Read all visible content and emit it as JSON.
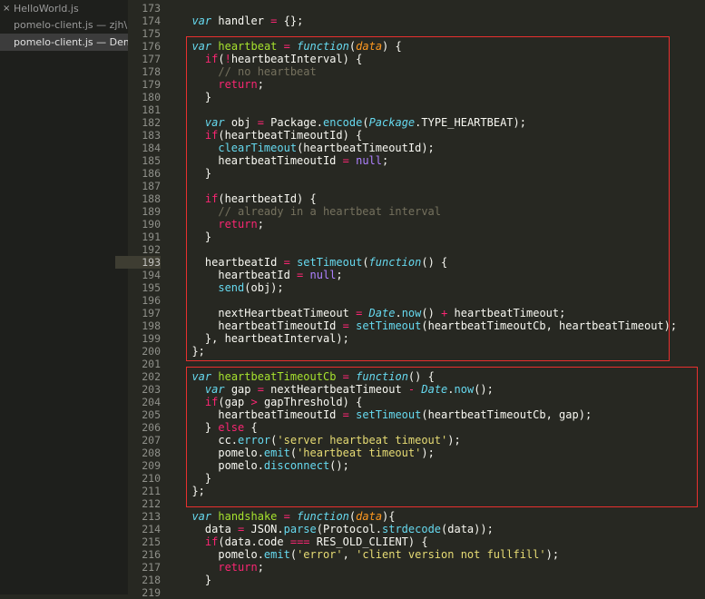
{
  "sidebar": {
    "files": [
      {
        "label": "HelloWorld.js",
        "close_icon": "×"
      },
      {
        "label": "pomelo-client.js — zjh\\..."
      },
      {
        "label": "pomelo-client.js — Demo"
      }
    ]
  },
  "editor": {
    "current_line": 193,
    "highlight_color": "#e8302f",
    "lines": [
      {
        "n": 173,
        "t": []
      },
      {
        "n": 174,
        "t": [
          [
            "",
            "  "
          ],
          [
            "st",
            "var"
          ],
          [
            "",
            " handler "
          ],
          [
            "op",
            "="
          ],
          [
            "",
            " {};"
          ]
        ]
      },
      {
        "n": 175,
        "t": []
      },
      {
        "n": 176,
        "t": [
          [
            "",
            "  "
          ],
          [
            "st",
            "var"
          ],
          [
            "",
            " "
          ],
          [
            "fn",
            "heartbeat"
          ],
          [
            "",
            " "
          ],
          [
            "op",
            "="
          ],
          [
            "",
            " "
          ],
          [
            "st",
            "function"
          ],
          [
            "",
            "("
          ],
          [
            "pa",
            "data"
          ],
          [
            "",
            ") {"
          ]
        ]
      },
      {
        "n": 177,
        "t": [
          [
            "",
            "    "
          ],
          [
            "kw",
            "if"
          ],
          [
            "",
            "("
          ],
          [
            "op",
            "!"
          ],
          [
            "",
            "heartbeatInterval) {"
          ]
        ]
      },
      {
        "n": 178,
        "t": [
          [
            "",
            "      "
          ],
          [
            "cm",
            "// no heartbeat"
          ]
        ]
      },
      {
        "n": 179,
        "t": [
          [
            "",
            "      "
          ],
          [
            "kw",
            "return"
          ],
          [
            "",
            ";"
          ]
        ]
      },
      {
        "n": 180,
        "t": [
          [
            "",
            "    }"
          ]
        ]
      },
      {
        "n": 181,
        "t": []
      },
      {
        "n": 182,
        "t": [
          [
            "",
            "    "
          ],
          [
            "st",
            "var"
          ],
          [
            "",
            " obj "
          ],
          [
            "op",
            "="
          ],
          [
            "",
            " Package."
          ],
          [
            "sp",
            "encode"
          ],
          [
            "",
            "("
          ],
          [
            "st",
            "Package"
          ],
          [
            "",
            ".TYPE_HEARTBEAT);"
          ]
        ]
      },
      {
        "n": 183,
        "t": [
          [
            "",
            "    "
          ],
          [
            "kw",
            "if"
          ],
          [
            "",
            "(heartbeatTimeoutId) {"
          ]
        ]
      },
      {
        "n": 184,
        "t": [
          [
            "",
            "      "
          ],
          [
            "sp",
            "clearTimeout"
          ],
          [
            "",
            "(heartbeatTimeoutId);"
          ]
        ]
      },
      {
        "n": 185,
        "t": [
          [
            "",
            "      heartbeatTimeoutId "
          ],
          [
            "op",
            "="
          ],
          [
            "",
            " "
          ],
          [
            "cn",
            "null"
          ],
          [
            "",
            ";"
          ]
        ]
      },
      {
        "n": 186,
        "t": [
          [
            "",
            "    }"
          ]
        ]
      },
      {
        "n": 187,
        "t": []
      },
      {
        "n": 188,
        "t": [
          [
            "",
            "    "
          ],
          [
            "kw",
            "if"
          ],
          [
            "",
            "(heartbeatId) {"
          ]
        ]
      },
      {
        "n": 189,
        "t": [
          [
            "",
            "      "
          ],
          [
            "cm",
            "// already in a heartbeat interval"
          ]
        ]
      },
      {
        "n": 190,
        "t": [
          [
            "",
            "      "
          ],
          [
            "kw",
            "return"
          ],
          [
            "",
            ";"
          ]
        ]
      },
      {
        "n": 191,
        "t": [
          [
            "",
            "    }"
          ]
        ]
      },
      {
        "n": 192,
        "t": []
      },
      {
        "n": 193,
        "t": [
          [
            "",
            "    heartbeatId "
          ],
          [
            "op",
            "="
          ],
          [
            "",
            " "
          ],
          [
            "sp",
            "setTimeout"
          ],
          [
            "",
            "("
          ],
          [
            "st",
            "function"
          ],
          [
            "",
            "() {"
          ]
        ]
      },
      {
        "n": 194,
        "t": [
          [
            "",
            "      heartbeatId "
          ],
          [
            "op",
            "="
          ],
          [
            "",
            " "
          ],
          [
            "cn",
            "null"
          ],
          [
            "",
            ";"
          ]
        ]
      },
      {
        "n": 195,
        "t": [
          [
            "",
            "      "
          ],
          [
            "sp",
            "send"
          ],
          [
            "",
            "(obj);"
          ]
        ]
      },
      {
        "n": 196,
        "t": []
      },
      {
        "n": 197,
        "t": [
          [
            "",
            "      nextHeartbeatTimeout "
          ],
          [
            "op",
            "="
          ],
          [
            "",
            " "
          ],
          [
            "st",
            "Date"
          ],
          [
            "",
            "."
          ],
          [
            "sp",
            "now"
          ],
          [
            "",
            "() "
          ],
          [
            "op",
            "+"
          ],
          [
            "",
            " heartbeatTimeout;"
          ]
        ]
      },
      {
        "n": 198,
        "t": [
          [
            "",
            "      heartbeatTimeoutId "
          ],
          [
            "op",
            "="
          ],
          [
            "",
            " "
          ],
          [
            "sp",
            "setTimeout"
          ],
          [
            "",
            "(heartbeatTimeoutCb, heartbeatTimeout);"
          ]
        ]
      },
      {
        "n": 199,
        "t": [
          [
            "",
            "    }, heartbeatInterval);"
          ]
        ]
      },
      {
        "n": 200,
        "t": [
          [
            "",
            "  };"
          ]
        ]
      },
      {
        "n": 201,
        "t": []
      },
      {
        "n": 202,
        "t": [
          [
            "",
            "  "
          ],
          [
            "st",
            "var"
          ],
          [
            "",
            " "
          ],
          [
            "fn",
            "heartbeatTimeoutCb"
          ],
          [
            "",
            " "
          ],
          [
            "op",
            "="
          ],
          [
            "",
            " "
          ],
          [
            "st",
            "function"
          ],
          [
            "",
            "() {"
          ]
        ]
      },
      {
        "n": 203,
        "t": [
          [
            "",
            "    "
          ],
          [
            "st",
            "var"
          ],
          [
            "",
            " gap "
          ],
          [
            "op",
            "="
          ],
          [
            "",
            " nextHeartbeatTimeout "
          ],
          [
            "op",
            "-"
          ],
          [
            "",
            " "
          ],
          [
            "st",
            "Date"
          ],
          [
            "",
            "."
          ],
          [
            "sp",
            "now"
          ],
          [
            "",
            "();"
          ]
        ]
      },
      {
        "n": 204,
        "t": [
          [
            "",
            "    "
          ],
          [
            "kw",
            "if"
          ],
          [
            "",
            "(gap "
          ],
          [
            "op",
            ">"
          ],
          [
            "",
            " gapThreshold) {"
          ]
        ]
      },
      {
        "n": 205,
        "t": [
          [
            "",
            "      heartbeatTimeoutId "
          ],
          [
            "op",
            "="
          ],
          [
            "",
            " "
          ],
          [
            "sp",
            "setTimeout"
          ],
          [
            "",
            "(heartbeatTimeoutCb, gap);"
          ]
        ]
      },
      {
        "n": 206,
        "t": [
          [
            "",
            "    } "
          ],
          [
            "kw",
            "else"
          ],
          [
            "",
            " {"
          ]
        ]
      },
      {
        "n": 207,
        "t": [
          [
            "",
            "      cc."
          ],
          [
            "sp",
            "error"
          ],
          [
            "",
            "("
          ],
          [
            "str",
            "'server heartbeat timeout'"
          ],
          [
            "",
            ");"
          ]
        ]
      },
      {
        "n": 208,
        "t": [
          [
            "",
            "      pomelo."
          ],
          [
            "sp",
            "emit"
          ],
          [
            "",
            "("
          ],
          [
            "str",
            "'heartbeat timeout'"
          ],
          [
            "",
            ");"
          ]
        ]
      },
      {
        "n": 209,
        "t": [
          [
            "",
            "      pomelo."
          ],
          [
            "sp",
            "disconnect"
          ],
          [
            "",
            "();"
          ]
        ]
      },
      {
        "n": 210,
        "t": [
          [
            "",
            "    }"
          ]
        ]
      },
      {
        "n": 211,
        "t": [
          [
            "",
            "  };"
          ]
        ]
      },
      {
        "n": 212,
        "t": []
      },
      {
        "n": 213,
        "t": [
          [
            "",
            "  "
          ],
          [
            "st",
            "var"
          ],
          [
            "",
            " "
          ],
          [
            "fn",
            "handshake"
          ],
          [
            "",
            " "
          ],
          [
            "op",
            "="
          ],
          [
            "",
            " "
          ],
          [
            "st",
            "function"
          ],
          [
            "",
            "("
          ],
          [
            "pa",
            "data"
          ],
          [
            "",
            "){"
          ]
        ]
      },
      {
        "n": 214,
        "t": [
          [
            "",
            "    data "
          ],
          [
            "op",
            "="
          ],
          [
            "",
            " JSON."
          ],
          [
            "sp",
            "parse"
          ],
          [
            "",
            "(Protocol."
          ],
          [
            "sp",
            "strdecode"
          ],
          [
            "",
            "(data));"
          ]
        ]
      },
      {
        "n": 215,
        "t": [
          [
            "",
            "    "
          ],
          [
            "kw",
            "if"
          ],
          [
            "",
            "(data.code "
          ],
          [
            "op",
            "==="
          ],
          [
            "",
            " RES_OLD_CLIENT) {"
          ]
        ]
      },
      {
        "n": 216,
        "t": [
          [
            "",
            "      pomelo."
          ],
          [
            "sp",
            "emit"
          ],
          [
            "",
            "("
          ],
          [
            "str",
            "'error'"
          ],
          [
            "",
            ", "
          ],
          [
            "str",
            "'client version not fullfill'"
          ],
          [
            "",
            ");"
          ]
        ]
      },
      {
        "n": 217,
        "t": [
          [
            "",
            "      "
          ],
          [
            "kw",
            "return"
          ],
          [
            "",
            ";"
          ]
        ]
      },
      {
        "n": 218,
        "t": [
          [
            "",
            "    }"
          ]
        ]
      },
      {
        "n": 219,
        "t": []
      }
    ]
  }
}
